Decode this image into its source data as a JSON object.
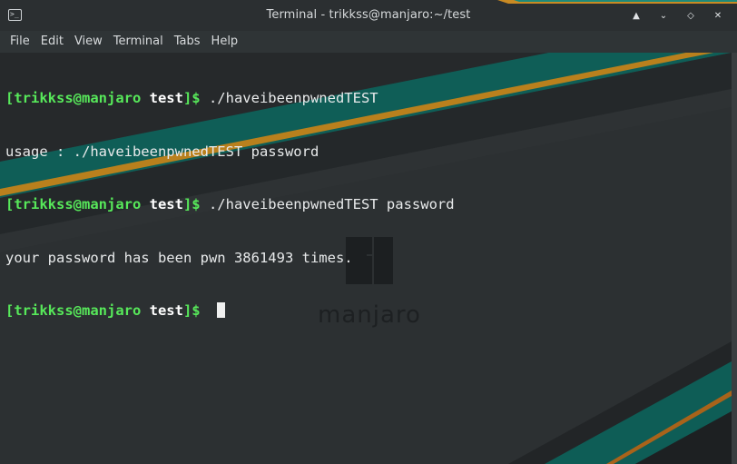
{
  "window": {
    "title": "Terminal - trikkss@manjaro:~/test",
    "app_icon_glyph": ">_",
    "controls": {
      "keep_above": "▲",
      "minimize": "⌄",
      "maximize": "◇",
      "close": "✕"
    }
  },
  "menu": {
    "items": [
      "File",
      "Edit",
      "View",
      "Terminal",
      "Tabs",
      "Help"
    ]
  },
  "terminal": {
    "lines": [
      {
        "prompt_user": "[trikkss@manjaro ",
        "prompt_dir": "test",
        "prompt_end": "]$ ",
        "command": "./haveibeenpwnedTEST"
      },
      {
        "output": "usage : ./haveibeenpwnedTEST password"
      },
      {
        "prompt_user": "[trikkss@manjaro ",
        "prompt_dir": "test",
        "prompt_end": "]$ ",
        "command": "./haveibeenpwnedTEST password"
      },
      {
        "output": "your password has been pwn 3861493 times."
      },
      {
        "prompt_user": "[trikkss@manjaro ",
        "prompt_dir": "test",
        "prompt_end": "]$ ",
        "command": ""
      }
    ]
  },
  "wallpaper": {
    "logo_text": "manjaro",
    "colors": {
      "teal": "#0f7167",
      "orange": "#c27a1a",
      "dark": "#1f2325"
    }
  },
  "colors": {
    "prompt_green": "#57e85a",
    "text": "#e8eaeb",
    "titlebar": "#2b2f31",
    "menubar": "#2f3436"
  }
}
